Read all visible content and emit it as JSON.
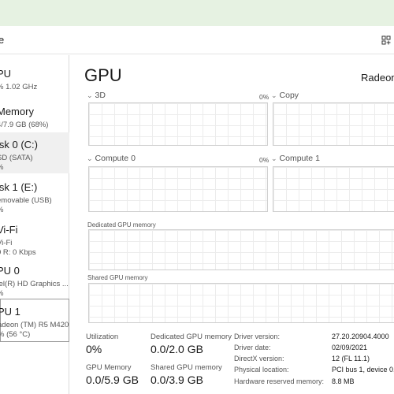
{
  "header": {
    "tab_fragment": "e"
  },
  "sidebar": {
    "items": [
      {
        "name": "PU",
        "sub1": "% 1.02 GHz",
        "sub2": ""
      },
      {
        "name": "Memory",
        "sub1": "4/7.9 GB (68%)",
        "sub2": ""
      },
      {
        "name": "isk 0 (C:)",
        "sub1": "SD (SATA)",
        "sub2": "%"
      },
      {
        "name": "isk 1 (E:)",
        "sub1": "emovable (USB)",
        "sub2": "%"
      },
      {
        "name": "Vi-Fi",
        "sub1": "Vi-Fi",
        "sub2": "0 R: 0 Kbps"
      },
      {
        "name": "PU 0",
        "sub1": "tel(R) HD Graphics ...",
        "sub2": "%"
      },
      {
        "name": "PU 1",
        "sub1": "adeon (TM) R5 M420",
        "sub2": "% (56 °C)"
      }
    ]
  },
  "main": {
    "title": "GPU",
    "model": "Radeon",
    "engines": [
      {
        "label": "3D",
        "pct": "0%"
      },
      {
        "label": "Copy",
        "pct": ""
      },
      {
        "label": "Compute 0",
        "pct": "0%"
      },
      {
        "label": "Compute 1",
        "pct": ""
      }
    ],
    "dedicated_label": "Dedicated GPU memory",
    "shared_label": "Shared GPU memory"
  },
  "stats": {
    "utilization_label": "Utilization",
    "utilization_value": "0%",
    "dedicated_label": "Dedicated GPU memory",
    "dedicated_value": "0.0/2.0 GB",
    "gpu_memory_label": "GPU Memory",
    "gpu_memory_value": "0.0/5.9 GB",
    "shared_label": "Shared GPU memory",
    "shared_value": "0.0/3.9 GB"
  },
  "properties": [
    {
      "label": "Driver version:",
      "value": "27.20.20904.4000"
    },
    {
      "label": "Driver date:",
      "value": "02/09/2021"
    },
    {
      "label": "DirectX version:",
      "value": "12 (FL 11.1)"
    },
    {
      "label": "Physical location:",
      "value": "PCI bus 1, device 0,"
    },
    {
      "label": "Hardware reserved memory:",
      "value": "8.8 MB"
    }
  ]
}
